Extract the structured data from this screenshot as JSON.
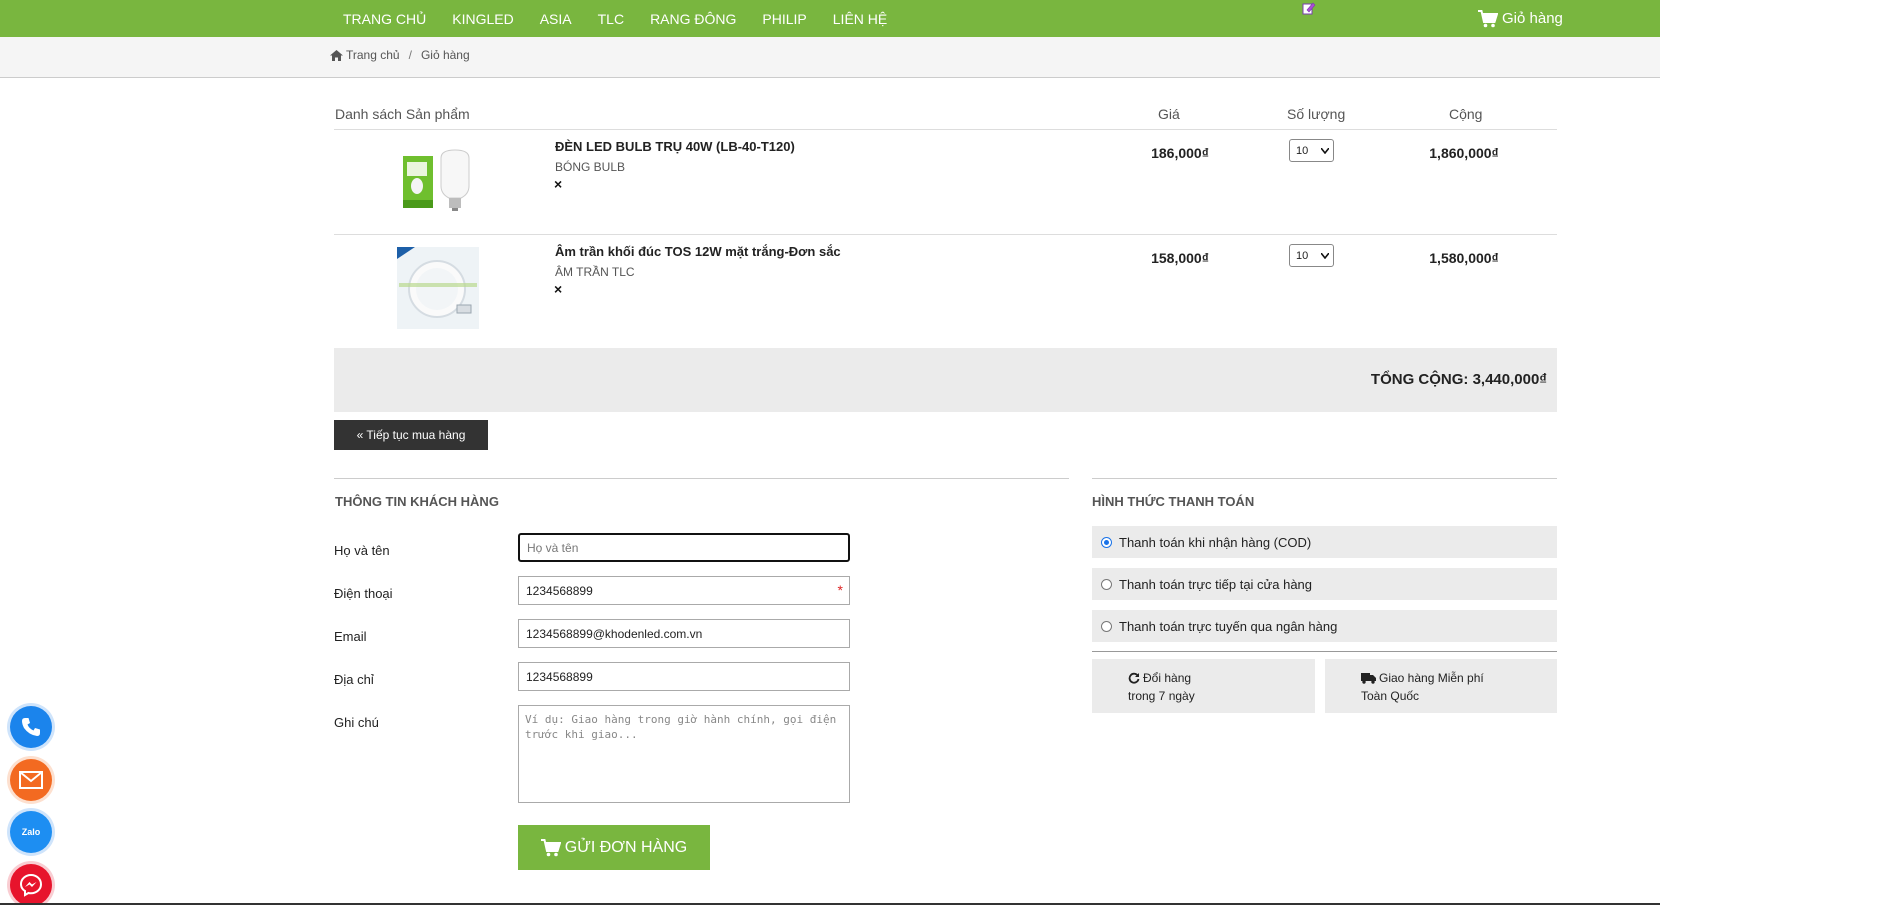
{
  "nav": {
    "items": [
      "TRANG CHỦ",
      "KINGLED",
      "ASIA",
      "TLC",
      "RANG ĐÔNG",
      "PHILIP",
      "LIÊN HỆ"
    ],
    "cart_label": "Giỏ hàng",
    "brand_color": "#79b63f"
  },
  "breadcrumb": {
    "home": "Trang chủ",
    "separator": "/",
    "current": "Giỏ hàng"
  },
  "cart": {
    "headers": {
      "products": "Danh sách Sản phẩm",
      "price": "Giá",
      "quantity": "Số lượng",
      "total": "Cộng"
    },
    "items": [
      {
        "name": "ĐÈN LED BULB TRỤ 40W (LB-40-T120)",
        "category": "BÓNG BULB",
        "remove": "×",
        "price": "186,000₫",
        "quantity": "10",
        "line_total": "1,860,000₫"
      },
      {
        "name": "Âm trần khối đúc TOS 12W mặt trắng-Đơn sắc",
        "category": "ÂM TRẦN TLC",
        "remove": "×",
        "price": "158,000₫",
        "quantity": "10",
        "line_total": "1,580,000₫"
      }
    ],
    "grand_total": "TỔNG CỘNG: 3,440,000₫",
    "continue_label": "« Tiếp tục mua hàng"
  },
  "customer": {
    "title": "THÔNG TIN KHÁCH HÀNG",
    "fields": {
      "name_label": "Họ và tên",
      "name_placeholder": "Họ và tên",
      "phone_label": "Điện thoại",
      "phone_value": "1234568899",
      "phone_required": "*",
      "email_label": "Email",
      "email_value": "1234568899@khodenled.com.vn",
      "address_label": "Địa chỉ",
      "address_value": "1234568899",
      "note_label": "Ghi chú",
      "note_placeholder": "Ví dụ: Giao hàng trong giờ hành chính, gọi điện trước khi giao..."
    },
    "submit_label": "GỬI ĐƠN HÀNG"
  },
  "payment": {
    "title": "HÌNH THỨC THANH TOÁN",
    "options": [
      {
        "label": "Thanh toán khi nhận hàng (COD)",
        "checked": true
      },
      {
        "label": "Thanh toán trực tiếp tại cửa hàng",
        "checked": false
      },
      {
        "label": "Thanh toán trực tuyến qua ngân hàng",
        "checked": false
      }
    ],
    "policies": [
      {
        "icon": "refresh-icon",
        "line1": "Đổi hàng",
        "line2": "trong 7 ngày"
      },
      {
        "icon": "truck-icon",
        "line1": "Giao hàng Miễn phí",
        "line2": "Toàn Quốc"
      }
    ]
  },
  "floating": {
    "zalo_label": "Zalo"
  }
}
